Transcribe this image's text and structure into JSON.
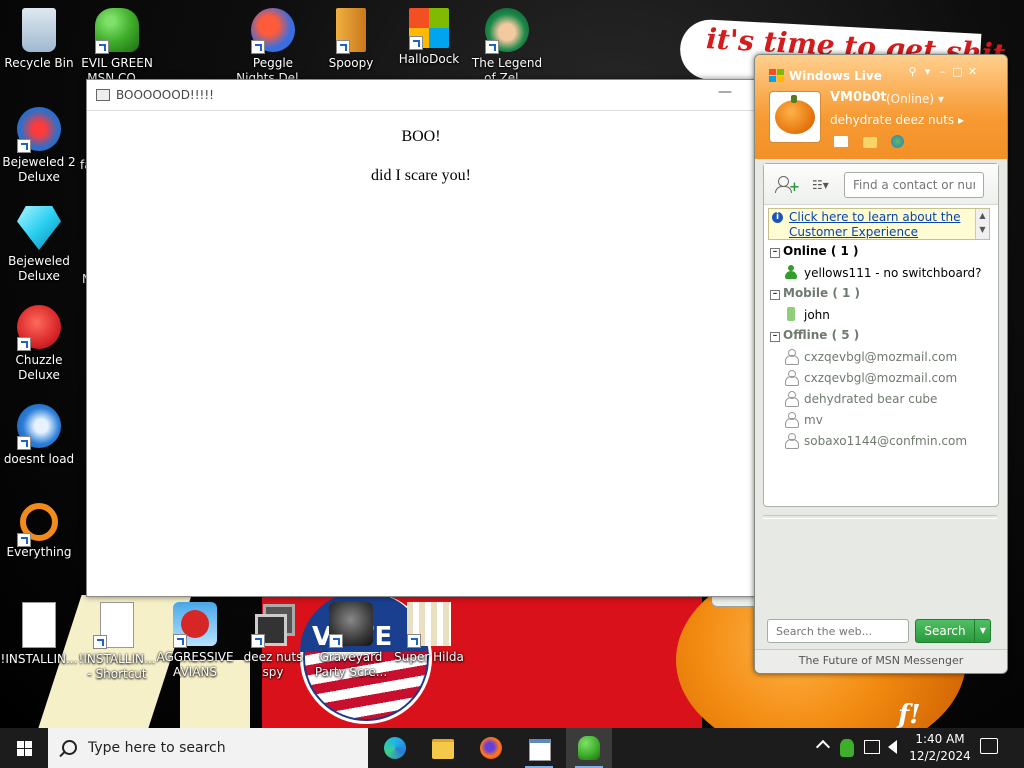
{
  "desktop": {
    "banner_text": "it's time to get shit",
    "bottom_text": "f!",
    "vote_text": "VOTE",
    "icons_left": [
      {
        "label": "Recycle Bin",
        "icon": "recycle-bin-icon",
        "color": "#9fb9d0"
      },
      {
        "label": "Bejeweled 2 Deluxe",
        "icon": "bejeweled2-icon",
        "color": "#2f6ec8"
      },
      {
        "label": "Bejeweled Deluxe",
        "icon": "bejeweled-icon",
        "color": "#2ad0f0"
      },
      {
        "label": "Chuzzle Deluxe",
        "icon": "chuzzle-icon",
        "color": "#d8262a"
      },
      {
        "label": "doesnt load",
        "icon": "thunderbird-icon",
        "color": "#2b7fd8"
      },
      {
        "label": "Everything",
        "icon": "everything-icon",
        "color": "#f28a1c"
      },
      {
        "label": "!INSTALLIN...",
        "icon": "document-icon",
        "color": "#ffffff"
      }
    ],
    "icons_top": [
      {
        "label": "EVIL GREEN MSN CO...",
        "icon": "msn-buddies-icon",
        "color": "#3fae2a"
      },
      {
        "label": "Peggle Nights Del...",
        "icon": "peggle-icon",
        "color": "#3a6ee0"
      },
      {
        "label": "Spoopy",
        "icon": "spoopy-icon",
        "color": "#f0b040"
      },
      {
        "label": "HalloDock",
        "icon": "windows-logo-icon",
        "color": "#f25022"
      },
      {
        "label": "The Legend of Zel...",
        "icon": "zelda-icon",
        "color": "#1c8a4a"
      }
    ],
    "icons_bottom": [
      {
        "label": "!INSTALLIN... - Shortcut",
        "icon": "document-shortcut-icon",
        "color": "#ffffff"
      },
      {
        "label": "AGGRESSIVE AVIANS",
        "icon": "angry-bird-icon",
        "color": "#d72626"
      },
      {
        "label": "deez nuts spy",
        "icon": "window-stack-icon",
        "color": "#555555"
      },
      {
        "label": "Graveyard Party Scre...",
        "icon": "graveyard-icon",
        "color": "#3a3a3a"
      },
      {
        "label": "Super Hilda",
        "icon": "pixel-character-icon",
        "color": "#e8e0c0"
      }
    ],
    "partial_labels": [
      "fa",
      "N"
    ]
  },
  "boo_window": {
    "title": "BOOOOOOD!!!!!",
    "minimize": "—",
    "line1": "BOO!",
    "line2": "did I scare you!"
  },
  "msn": {
    "logo_text": "Windows Live",
    "display_name": "VM0b0t",
    "status": "(Online)",
    "status_arrow": "▾",
    "personal_message": "dehydrate deez nuts",
    "personal_arrow": "▸",
    "find_placeholder": "Find a contact or number...",
    "info_link": "Click here to learn about the Customer Experience",
    "groups": [
      {
        "label": "Online ( 1 )",
        "color": "#000000",
        "contacts": [
          {
            "name": "yellows111 - no switchboard?",
            "state": "online"
          }
        ]
      },
      {
        "label": "Mobile ( 1 )",
        "color": "#6e7a6e",
        "contacts": [
          {
            "name": "john",
            "state": "mobile"
          }
        ]
      },
      {
        "label": "Offline ( 5 )",
        "color": "#6e7a6e",
        "contacts": [
          {
            "name": "cxzqevbgl@mozmail.com",
            "state": "offline"
          },
          {
            "name": "cxzqevbgl@mozmail.com",
            "state": "offline"
          },
          {
            "name": "dehydrated bear cube",
            "state": "offline"
          },
          {
            "name": "mv",
            "state": "offline"
          },
          {
            "name": "sobaxo1144@confmin.com",
            "state": "offline"
          }
        ]
      }
    ],
    "web_search_placeholder": "Search the web...",
    "search_button": "Search",
    "footer": "The Future of MSN Messenger",
    "accent": "#f79a33"
  },
  "taskbar": {
    "search_placeholder": "Type here to search",
    "time": "1:40 AM",
    "date": "12/2/2024",
    "apps": [
      "edge-icon",
      "file-explorer-icon",
      "firefox-icon",
      "boo-app-icon",
      "msn-messenger-icon"
    ]
  }
}
